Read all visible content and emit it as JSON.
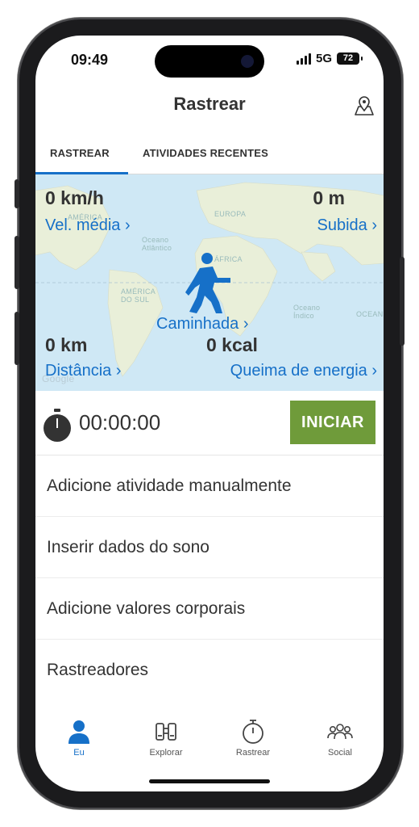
{
  "status": {
    "time": "09:49",
    "network": "5G",
    "battery": "72"
  },
  "header": {
    "title": "Rastrear",
    "map_icon": "map-pin-icon"
  },
  "tabs": [
    {
      "label": "RASTREAR",
      "active": true
    },
    {
      "label": "ATIVIDADES RECENTES",
      "active": false
    }
  ],
  "map": {
    "labels": [
      "AMÉRICA",
      "EUROPA",
      "Oceano Atlântico",
      "ÁFRICA",
      "AMÉRICA DO SUL",
      "Oceano Índico",
      "OCEAN",
      "Google"
    ],
    "activity_icon": "walking-person-icon"
  },
  "stats": {
    "speed": {
      "value": "0 km/h",
      "label": "Vel. média ›"
    },
    "climb": {
      "value": "0 m",
      "label": "Subida ›"
    },
    "activity": {
      "label": "Caminhada ›"
    },
    "distance": {
      "value": "0 km",
      "label": "Distância ›"
    },
    "energy": {
      "value": "0 kcal",
      "label": "Queima de energia ›"
    }
  },
  "timer": {
    "value": "00:00:00",
    "start_label": "INICIAR",
    "icon": "stopwatch-icon"
  },
  "list": [
    {
      "label": "Adicione atividade manualmente"
    },
    {
      "label": "Inserir dados do sono"
    },
    {
      "label": "Adicione valores corporais"
    },
    {
      "label": "Rastreadores"
    }
  ],
  "nav": [
    {
      "label": "Eu",
      "icon": "person-icon",
      "active": true
    },
    {
      "label": "Explorar",
      "icon": "binoculars-icon",
      "active": false
    },
    {
      "label": "Rastrear",
      "icon": "stopwatch-icon",
      "active": false
    },
    {
      "label": "Social",
      "icon": "group-icon",
      "active": false
    }
  ],
  "colors": {
    "accent": "#1670c8",
    "start": "#6f9b3a",
    "map_bg": "#cfe8f5"
  }
}
